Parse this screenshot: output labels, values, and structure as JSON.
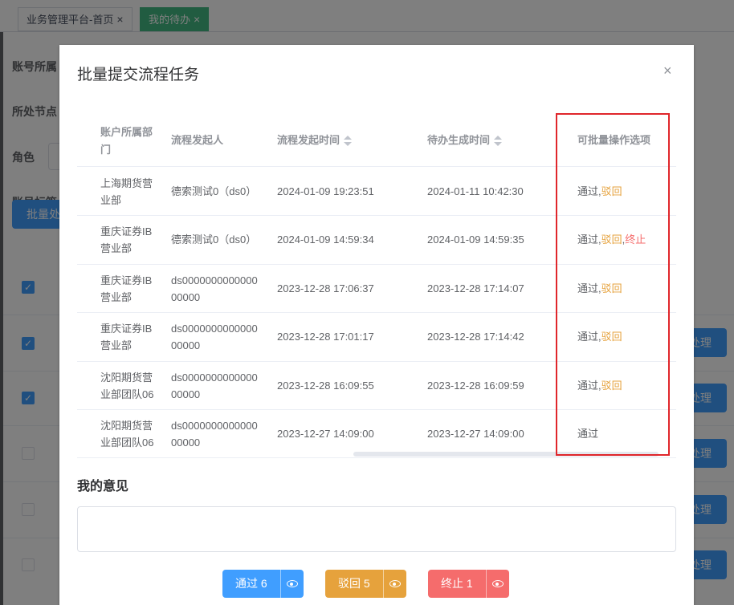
{
  "tabs": [
    {
      "label": "业务管理平台-首页",
      "active": false
    },
    {
      "label": "我的待办",
      "active": true
    }
  ],
  "background": {
    "labels": [
      "账号所属",
      "所处节点",
      "角色",
      "账号标签"
    ],
    "batch_button": "批量处",
    "handle_button": "处理"
  },
  "dialog": {
    "title": "批量提交流程任务",
    "close": "×",
    "columns": [
      "账户所属部门",
      "流程发起人",
      "流程发起时间",
      "待办生成时间",
      "可批量操作选项"
    ],
    "rows": [
      {
        "dept": [
          "上海期货营",
          "业部"
        ],
        "initiator": [
          "德索测试0（ds0）"
        ],
        "start": "2024-01-09 19:23:51",
        "created": "2024-01-11 10:42:30",
        "options": [
          {
            "text": "通过",
            "type": "pass"
          },
          {
            "text": ",",
            "type": "pass"
          },
          {
            "text": "驳回",
            "type": "back"
          }
        ]
      },
      {
        "dept": [
          "重庆证券IB",
          "营业部"
        ],
        "initiator": [
          "德索测试0（ds0）"
        ],
        "start": "2024-01-09 14:59:34",
        "created": "2024-01-09 14:59:35",
        "options": [
          {
            "text": "通过",
            "type": "pass"
          },
          {
            "text": ",",
            "type": "pass"
          },
          {
            "text": "驳回",
            "type": "back"
          },
          {
            "text": ",",
            "type": "pass"
          },
          {
            "text": "终止",
            "type": "stop"
          }
        ]
      },
      {
        "dept": [
          "重庆证券IB",
          "营业部"
        ],
        "initiator": [
          "ds0000000000000",
          "00000"
        ],
        "start": "2023-12-28 17:06:37",
        "created": "2023-12-28 17:14:07",
        "options": [
          {
            "text": "通过",
            "type": "pass"
          },
          {
            "text": ",",
            "type": "pass"
          },
          {
            "text": "驳回",
            "type": "back"
          }
        ]
      },
      {
        "dept": [
          "重庆证券IB",
          "营业部"
        ],
        "initiator": [
          "ds0000000000000",
          "00000"
        ],
        "start": "2023-12-28 17:01:17",
        "created": "2023-12-28 17:14:42",
        "options": [
          {
            "text": "通过",
            "type": "pass"
          },
          {
            "text": ",",
            "type": "pass"
          },
          {
            "text": "驳回",
            "type": "back"
          }
        ]
      },
      {
        "dept": [
          "沈阳期货营",
          "业部团队06"
        ],
        "initiator": [
          "ds0000000000000",
          "00000"
        ],
        "start": "2023-12-28 16:09:55",
        "created": "2023-12-28 16:09:59",
        "options": [
          {
            "text": "通过",
            "type": "pass"
          },
          {
            "text": ",",
            "type": "pass"
          },
          {
            "text": "驳回",
            "type": "back"
          }
        ]
      },
      {
        "dept": [
          "沈阳期货营",
          "业部团队06"
        ],
        "initiator": [
          "ds0000000000000",
          "00000"
        ],
        "start": "2023-12-27 14:09:00",
        "created": "2023-12-27 14:09:00",
        "options": [
          {
            "text": "通过",
            "type": "pass"
          }
        ]
      }
    ],
    "opinion_label": "我的意见",
    "opinion_value": "",
    "buttons": [
      {
        "label": "通过 6",
        "color": "#409eff"
      },
      {
        "label": "驳回 5",
        "color": "#e6a23c"
      },
      {
        "label": "终止 1",
        "color": "#f56c6c"
      }
    ]
  }
}
